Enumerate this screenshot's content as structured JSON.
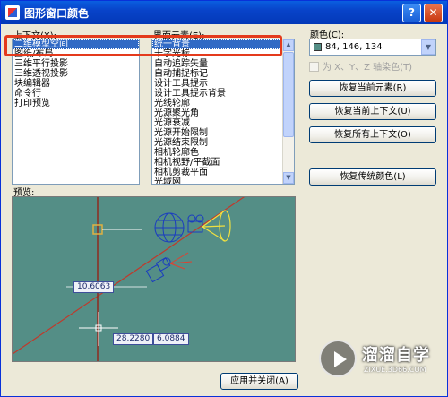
{
  "window": {
    "title": "图形窗口颜色",
    "help_label": "?",
    "close_label": "✕"
  },
  "context": {
    "label": "上下文(X):",
    "items": [
      "二维模型空间",
      "图纸/布局",
      "三维平行投影",
      "三维透视投影",
      "块编辑器",
      "命令行",
      "打印预览"
    ],
    "selected_index": 0
  },
  "elements": {
    "label": "界面元素(E):",
    "items": [
      "统一背景",
      "十字光标",
      "自动追踪矢量",
      "自动捕捉标记",
      "设计工具提示",
      "设计工具提示背景",
      "光线轮廓",
      "光源聚光角",
      "光源衰减",
      "光源开始限制",
      "光源结束限制",
      "相机轮廓色",
      "相机视野/平截面",
      "相机剪裁平面",
      "光域网"
    ],
    "selected_index": 0
  },
  "color": {
    "label": "颜色(C):",
    "value": "84, 146, 134",
    "swatch": "#548e86",
    "tint_label": "为 X、Y、Z 轴染色(T)",
    "tint_checked": false
  },
  "buttons": {
    "restore_element": "恢复当前元素(R)",
    "restore_context": "恢复当前上下文(U)",
    "restore_all": "恢复所有上下文(O)",
    "restore_classic": "恢复传统颜色(L)",
    "apply_close": "应用并关闭(A)"
  },
  "preview": {
    "label": "预览:",
    "background": "#548e86",
    "coord_value_1": "10.6063",
    "coord_value_2": "28.2280",
    "coord_value_3": "6.0884"
  },
  "watermark": {
    "title": "溜溜自学",
    "subtitle": "ZIXUE.3D66.COM"
  }
}
